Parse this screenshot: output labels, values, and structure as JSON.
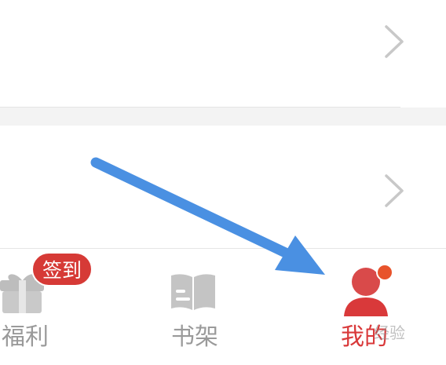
{
  "menu": {
    "rows": [
      {
        "chevron_icon": "chevron-right-icon"
      },
      {
        "chevron_icon": "chevron-right-icon"
      }
    ]
  },
  "tabbar": {
    "tabs": [
      {
        "label": "福利",
        "icon": "gift-icon",
        "badge": "签到",
        "active": false
      },
      {
        "label": "书架",
        "icon": "book-icon",
        "active": false
      },
      {
        "label": "我的",
        "icon": "user-icon",
        "active": true
      }
    ]
  },
  "colors": {
    "accent": "#d9393a",
    "inactive": "#9a9a9a",
    "badge": "#d63a36",
    "notify_dot": "#e8532b",
    "annotation_arrow": "#4a90e2"
  },
  "overlay": {
    "watermark": "经验"
  }
}
